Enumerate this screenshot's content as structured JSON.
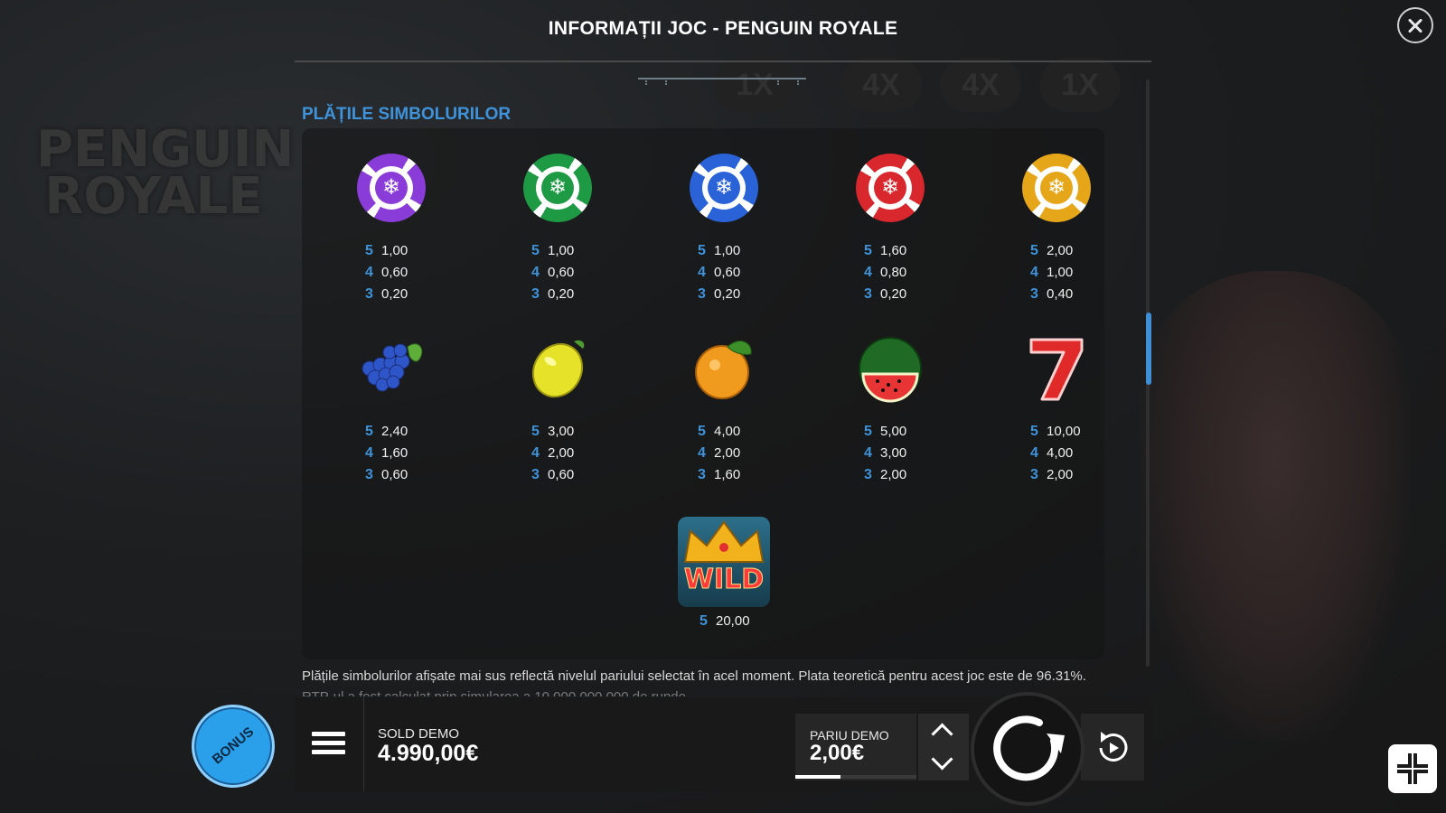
{
  "header": {
    "title": "INFORMAȚII JOC - PENGUIN ROYALE"
  },
  "section": {
    "title": "PLĂȚILE SIMBOLURILOR"
  },
  "symbols": [
    {
      "name": "purple-chip",
      "color": "#8a3cd8",
      "pays": [
        {
          "n": "5",
          "v": "1,00"
        },
        {
          "n": "4",
          "v": "0,60"
        },
        {
          "n": "3",
          "v": "0,20"
        }
      ]
    },
    {
      "name": "green-chip",
      "color": "#1f9a44",
      "pays": [
        {
          "n": "5",
          "v": "1,00"
        },
        {
          "n": "4",
          "v": "0,60"
        },
        {
          "n": "3",
          "v": "0,20"
        }
      ]
    },
    {
      "name": "blue-chip",
      "color": "#2a63d8",
      "pays": [
        {
          "n": "5",
          "v": "1,00"
        },
        {
          "n": "4",
          "v": "0,60"
        },
        {
          "n": "3",
          "v": "0,20"
        }
      ]
    },
    {
      "name": "red-chip",
      "color": "#d8272d",
      "pays": [
        {
          "n": "5",
          "v": "1,60"
        },
        {
          "n": "4",
          "v": "0,80"
        },
        {
          "n": "3",
          "v": "0,20"
        }
      ]
    },
    {
      "name": "gold-chip",
      "color": "#e6a61a",
      "pays": [
        {
          "n": "5",
          "v": "2,00"
        },
        {
          "n": "4",
          "v": "1,00"
        },
        {
          "n": "3",
          "v": "0,40"
        }
      ]
    },
    {
      "name": "grapes",
      "pays": [
        {
          "n": "5",
          "v": "2,40"
        },
        {
          "n": "4",
          "v": "1,60"
        },
        {
          "n": "3",
          "v": "0,60"
        }
      ]
    },
    {
      "name": "lemon",
      "pays": [
        {
          "n": "5",
          "v": "3,00"
        },
        {
          "n": "4",
          "v": "2,00"
        },
        {
          "n": "3",
          "v": "0,60"
        }
      ]
    },
    {
      "name": "orange",
      "pays": [
        {
          "n": "5",
          "v": "4,00"
        },
        {
          "n": "4",
          "v": "2,00"
        },
        {
          "n": "3",
          "v": "1,60"
        }
      ]
    },
    {
      "name": "watermelon",
      "pays": [
        {
          "n": "5",
          "v": "5,00"
        },
        {
          "n": "4",
          "v": "3,00"
        },
        {
          "n": "3",
          "v": "2,00"
        }
      ]
    },
    {
      "name": "seven",
      "pays": [
        {
          "n": "5",
          "v": "10,00"
        },
        {
          "n": "4",
          "v": "4,00"
        },
        {
          "n": "3",
          "v": "2,00"
        }
      ]
    },
    {
      "name": "wild",
      "label": "WILD",
      "pays": [
        {
          "n": "5",
          "v": "20,00"
        }
      ]
    }
  ],
  "footer": {
    "note": "Plățile simbolurilor afișate mai sus reflectă nivelul pariului selectat în acel moment. Plata teoretică pentru acest joc este de 96.31%.",
    "note2": "RTP-ul a fost calculat prin simularea a 10.000.000.000 de runde."
  },
  "bonus": {
    "label": "BONUS"
  },
  "balance": {
    "label": "SOLD DEMO",
    "value": "4.990,00€"
  },
  "bet": {
    "label": "PARIU DEMO",
    "value": "2,00€",
    "level": 0.37
  },
  "background": {
    "logo": "PENGUIN ROYALE",
    "multipliers": [
      "1X",
      "4X",
      "4X",
      "1X"
    ]
  },
  "colors": {
    "accent": "#3f93da",
    "bonus": "#2aa0ea"
  }
}
